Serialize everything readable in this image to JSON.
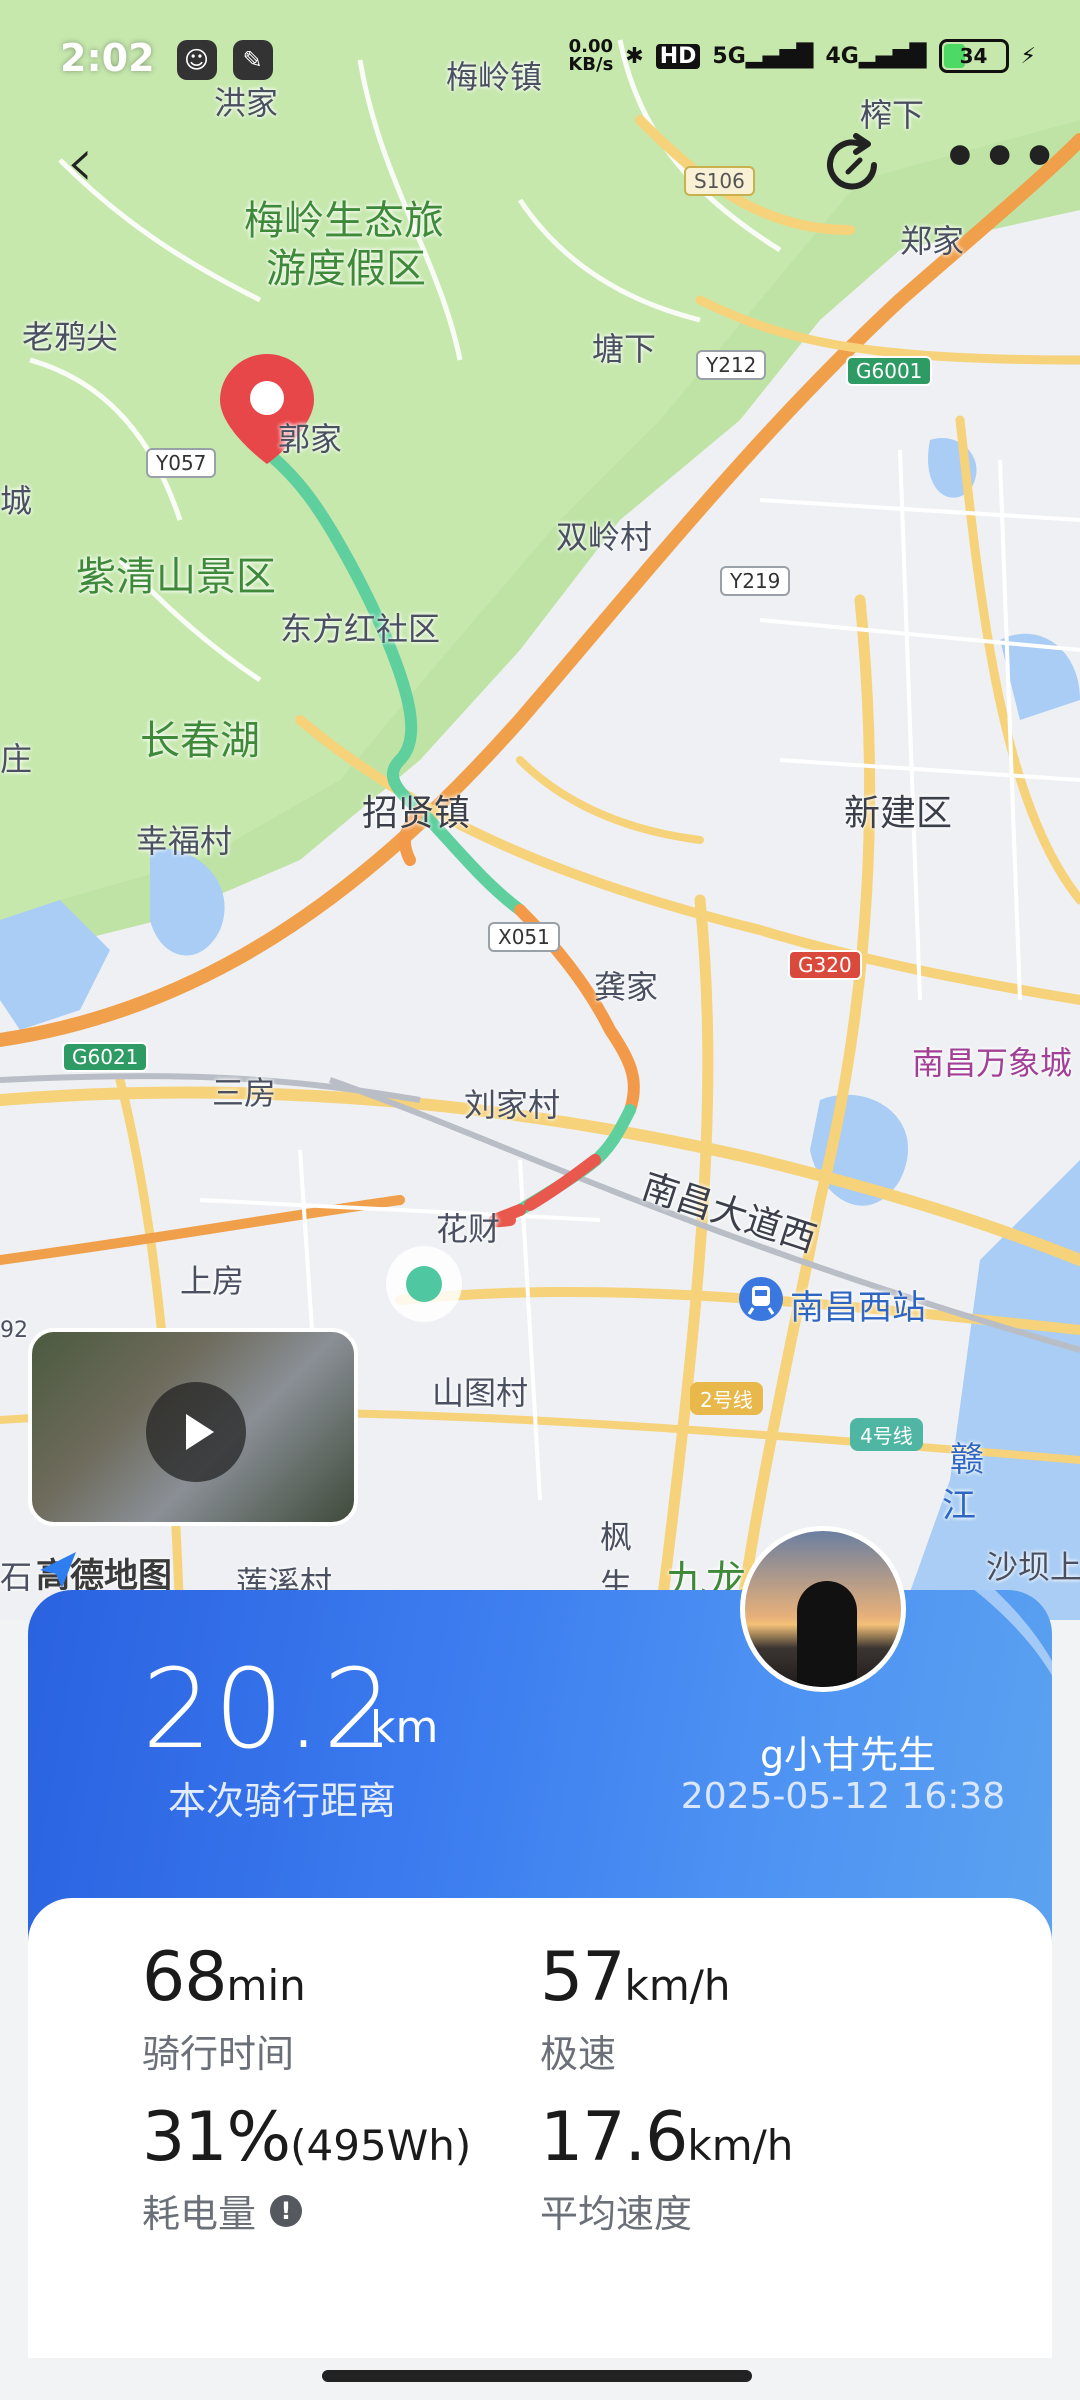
{
  "status_bar": {
    "time": "2:02",
    "net_speed_value": "0.00",
    "net_speed_unit": "KB/s",
    "hd_label": "HD",
    "signal_5g": "5G",
    "signal_4g": "4G",
    "battery_level": "34",
    "battery_fraction": 0.34
  },
  "map": {
    "labels": {
      "hongjia": "洪家",
      "meiling_town": "梅岭镇",
      "zhaxia": "榨下",
      "zhengjia": "郑家",
      "meiling_resort": "梅岭生态旅",
      "meiling_resort_2": "游度假区",
      "laoyatou": "老鸦尖",
      "tangxia": "塘下",
      "cheng": "城",
      "zijia": "郭家",
      "shuangling": "双岭村",
      "ziqing": "紫清山景区",
      "dongfanghong": "东方红社区",
      "changchunhu": "长春湖",
      "zhuang": "庄",
      "zhaoxian": "招贤镇",
      "xinjian": "新建区",
      "xingfu": "幸福村",
      "gongjia": "龚家",
      "nanchang_mixc": "南昌万象城",
      "sanfang": "三房",
      "liujia": "刘家村",
      "nanchang_avenue": "南昌大道西",
      "huacai": "花财",
      "nanchang_west": "南昌西站",
      "shangfang": "上房",
      "num_92": "92",
      "shantu": "山图村",
      "ganjiang_1": "赣",
      "ganjiang_2": "江",
      "shaba": "沙坝上",
      "feng": "枫",
      "sheng": "生",
      "jiulong": "九龙",
      "shixi": "石",
      "qixi": "莲溪村"
    },
    "road_tags": {
      "s106": "S106",
      "y212": "Y212",
      "g6001": "G6001",
      "y057": "Y057",
      "y219": "Y219",
      "x051": "X051",
      "g320": "G320",
      "g6021": "G6021"
    },
    "metro": {
      "line2": "2号线",
      "line4": "4号线"
    },
    "amap_logo": "高德地图"
  },
  "ride": {
    "distance_value": "20.2",
    "distance_unit": "km",
    "distance_label": "本次骑行距离",
    "user_name": "g小甘先生",
    "date_time": "2025-05-12 16:38"
  },
  "stats": {
    "duration_value": "68",
    "duration_unit": "min",
    "duration_label": "骑行时间",
    "top_speed_value": "57",
    "top_speed_unit": "km/h",
    "top_speed_label": "极速",
    "battery_used_value": "31%",
    "battery_used_extra": "(495Wh)",
    "battery_used_label": "耗电量",
    "avg_speed_value": "17.6",
    "avg_speed_unit": "km/h",
    "avg_speed_label": "平均速度"
  },
  "icons": {
    "back": "back-arrow-icon",
    "share": "refresh-share-icon",
    "more": "more-dots-icon",
    "start_pin": "map-pin-icon",
    "end_marker": "end-point-icon",
    "play": "play-icon",
    "info": "info-icon",
    "amap": "amap-logo-icon",
    "station": "railway-station-icon"
  },
  "colors": {
    "map_green": "#bfe3a5",
    "map_land": "#eef0f3",
    "road_yellow": "#f6d27a",
    "road_orange": "#f0a04b",
    "water": "#a9cdf4",
    "route_green": "#5fcf9e",
    "route_orange": "#f39a4a",
    "route_red": "#e8584c",
    "card_blue": "#3b7bef"
  }
}
